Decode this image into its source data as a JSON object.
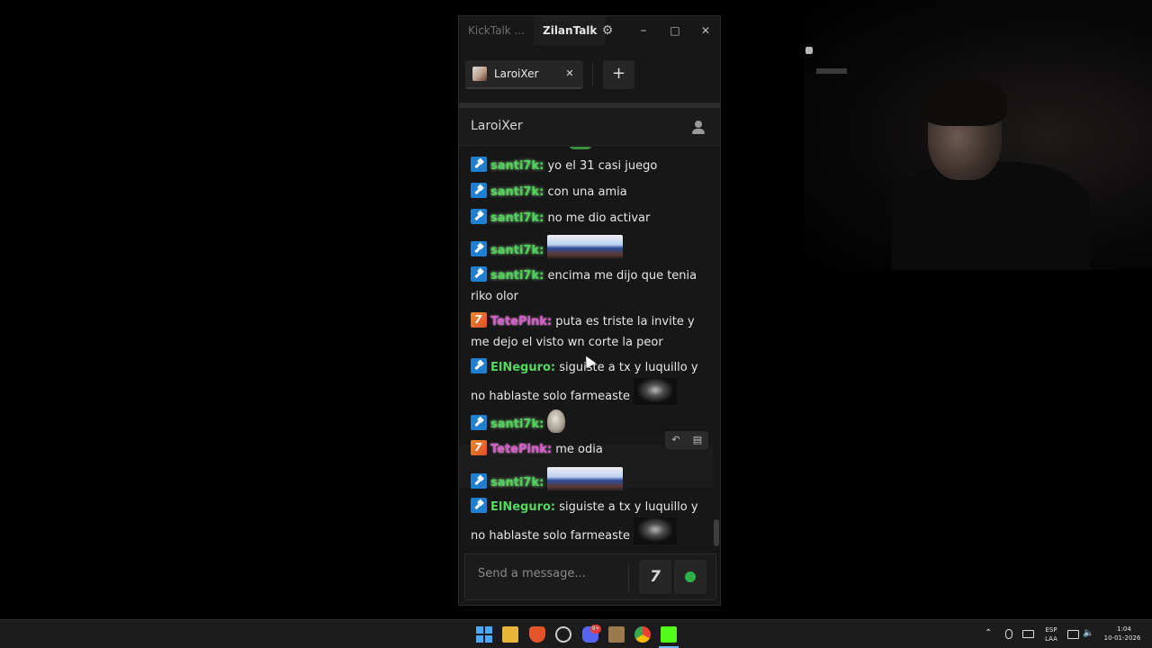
{
  "window": {
    "tabs": [
      "KickTalk ...",
      "ZilanTalk"
    ],
    "controls": {
      "settings": "⚙",
      "minimize": "–",
      "maximize": "□",
      "close": "✕"
    }
  },
  "streamer_tabs": [
    {
      "label": "LaroiXer",
      "close": "✕"
    }
  ],
  "add_tab_label": "+",
  "chat_header": {
    "title": "LaroiXer"
  },
  "messages": [
    {
      "badge": "mod",
      "user": "santi7k:",
      "text": "yo el 31 casi juego"
    },
    {
      "badge": "mod",
      "user": "santi7k:",
      "text": "con una amia"
    },
    {
      "badge": "mod",
      "user": "santi7k:",
      "text": "no me dio activar"
    },
    {
      "badge": "mod",
      "user": "santi7k:",
      "text": "",
      "emote": "car-emote"
    },
    {
      "badge": "mod",
      "user": "santi7k:",
      "text": "encima me dijo que tenia riko olor"
    },
    {
      "badge": "orange",
      "user": "TetePink:",
      "text": "puta es triste la invite y me dejo el visto wn corte la peor"
    },
    {
      "badge": "mod",
      "user": "ElNeguro:",
      "text": "siguiste a tx y luquillo y no hablaste solo farmeaste",
      "emote": "dark-emote"
    },
    {
      "badge": "mod",
      "user": "santi7k:",
      "text": "",
      "emote": "skull-emote"
    },
    {
      "badge": "orange",
      "user": "TetePink:",
      "text": "me odia"
    },
    {
      "badge": "mod",
      "user": "santi7k:",
      "text": "",
      "emote": "car-emote"
    },
    {
      "badge": "mod",
      "user": "ElNeguro:",
      "text": "siguiste a tx y luquillo y no hablaste solo farmeaste",
      "emote": "dark-emote"
    }
  ],
  "message_actions": {
    "reply": "↶",
    "copy": "▤"
  },
  "input": {
    "placeholder": "Send a message..."
  },
  "input_emote_button": "7",
  "taskbar": {
    "lang_top": "ESP",
    "lang_bottom": "LAA",
    "time": "1:04",
    "date": "10-01-2026",
    "discord_badge": "9+"
  },
  "colors": {
    "santi7k": "#4ed35a",
    "TetePink": "#d35ec6",
    "ElNeguro": "#55d85e",
    "accent_send": "#2cb24b"
  }
}
